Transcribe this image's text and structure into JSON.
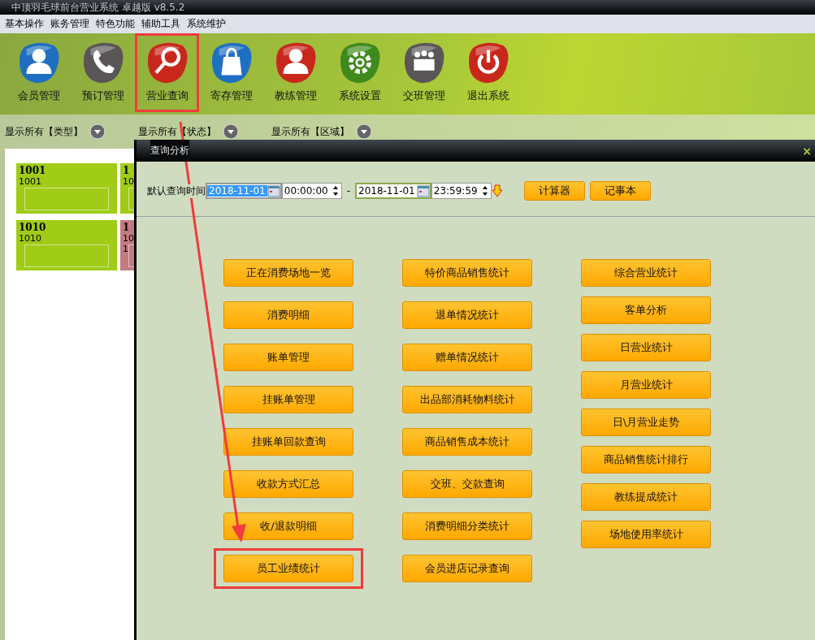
{
  "window": {
    "title": "中顶羽毛球前台营业系统 卓越版 v8.5.2"
  },
  "menu": [
    "基本操作",
    "账务管理",
    "特色功能",
    "辅助工具",
    "系统维护"
  ],
  "toolbar": [
    {
      "label": "会员管理",
      "kind": "person",
      "color": "#1f6fc0",
      "highlighted": false
    },
    {
      "label": "预订管理",
      "kind": "phone",
      "color": "#5a5658",
      "highlighted": false
    },
    {
      "label": "营业查询",
      "kind": "search",
      "color": "#c8281c",
      "highlighted": true
    },
    {
      "label": "寄存管理",
      "kind": "bag",
      "color": "#1f6fc0",
      "highlighted": false
    },
    {
      "label": "教练管理",
      "kind": "person",
      "color": "#c8281c",
      "highlighted": false
    },
    {
      "label": "系统设置",
      "kind": "gear",
      "color": "#3f8a1c",
      "highlighted": false
    },
    {
      "label": "交班管理",
      "kind": "group",
      "color": "#5a5658",
      "highlighted": false
    },
    {
      "label": "退出系统",
      "kind": "power",
      "color": "#c8281c",
      "highlighted": false
    }
  ],
  "filters": [
    "显示所有【类型】",
    "显示所有【状态】",
    "显示所有【区域】"
  ],
  "courts": [
    {
      "title": "1001",
      "name": "1001",
      "color": "#a0cc18"
    },
    {
      "title": "1",
      "name": "10",
      "color": "#a0cc18"
    },
    {
      "title": "1010",
      "name": "1010",
      "color": "#a0cc18"
    },
    {
      "title": "1",
      "name": "10",
      "extra": "1",
      "color": "#c07c80"
    }
  ],
  "dialog": {
    "title": "查询分析",
    "close": "×",
    "query_label": "默认查询时间",
    "from_date": {
      "value": "2018-11-01",
      "selected": true
    },
    "from_time": "00:00:00",
    "separator": "-",
    "to_date": {
      "value": "2018-11-01",
      "selected": false
    },
    "to_time": "23:59:59",
    "tools": [
      "计算器",
      "记事本"
    ],
    "columns": [
      [
        {
          "label": "正在消费场地一览",
          "highlighted": false
        },
        {
          "label": "消费明细",
          "highlighted": false
        },
        {
          "label": "账单管理",
          "highlighted": false
        },
        {
          "label": "挂账单管理",
          "highlighted": false
        },
        {
          "label": "挂账单回款查询",
          "highlighted": false
        },
        {
          "label": "收款方式汇总",
          "highlighted": false
        },
        {
          "label": "收/退款明细",
          "highlighted": false
        },
        {
          "label": "员工业绩统计",
          "highlighted": true
        }
      ],
      [
        {
          "label": "特价商品销售统计",
          "highlighted": false
        },
        {
          "label": "退单情况统计",
          "highlighted": false
        },
        {
          "label": "赠单情况统计",
          "highlighted": false
        },
        {
          "label": "出品部消耗物料统计",
          "highlighted": false
        },
        {
          "label": "商品销售成本统计",
          "highlighted": false
        },
        {
          "label": "交班、交款查询",
          "highlighted": false
        },
        {
          "label": "消费明细分类统计",
          "highlighted": false
        },
        {
          "label": "会员进店记录查询",
          "highlighted": false
        }
      ],
      [
        {
          "label": "综合营业统计",
          "highlighted": false
        },
        {
          "label": "客单分析",
          "highlighted": false
        },
        {
          "label": "日营业统计",
          "highlighted": false
        },
        {
          "label": "月营业统计",
          "highlighted": false
        },
        {
          "label": "日\\月营业走势",
          "highlighted": false
        },
        {
          "label": "商品销售统计排行",
          "highlighted": false
        },
        {
          "label": "教练提成统计",
          "highlighted": false
        },
        {
          "label": "场地使用率统计",
          "highlighted": false
        }
      ]
    ]
  }
}
